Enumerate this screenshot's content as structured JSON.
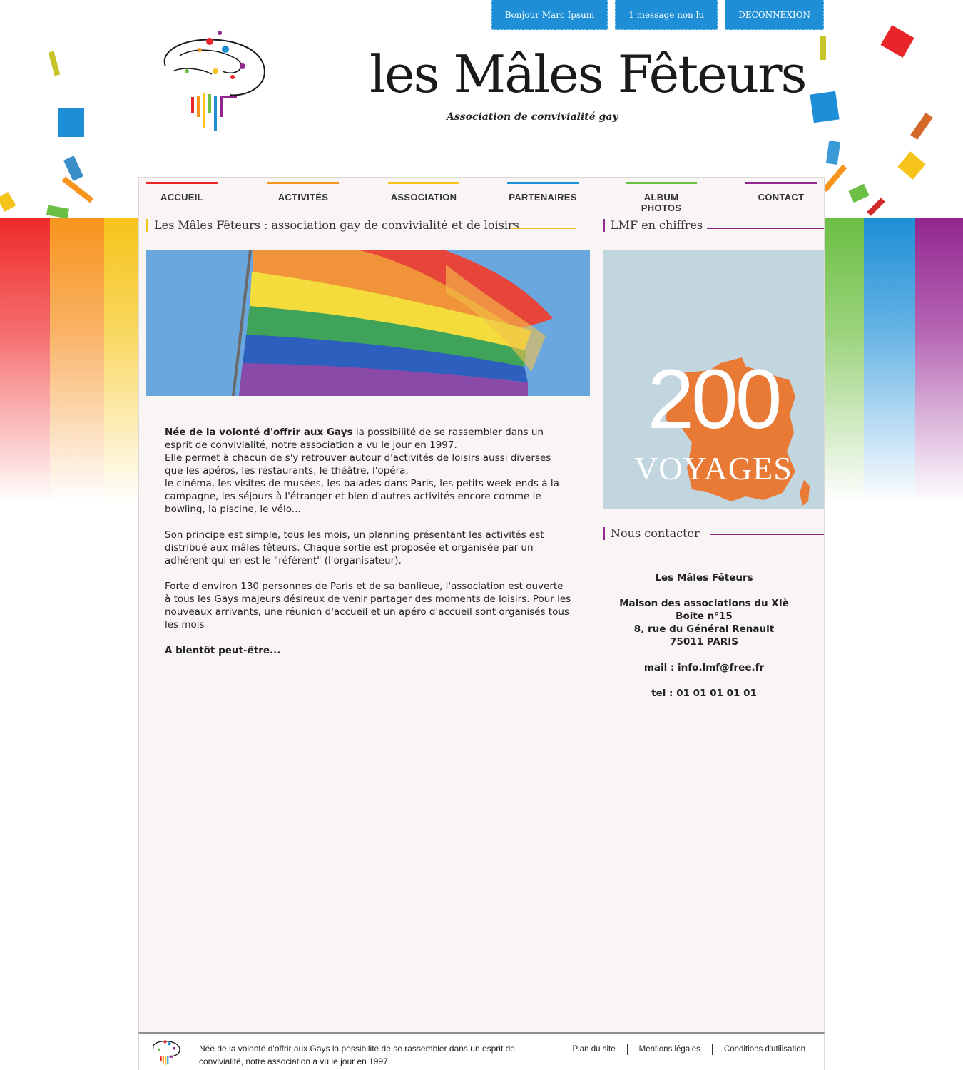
{
  "userbar": {
    "greeting": "Bonjour Marc Ipsum",
    "messages": "1 message non lu",
    "logout": "DECONNEXION"
  },
  "brand": {
    "title": "les Mâles Fêteurs",
    "tagline": "Association de convivialité gay"
  },
  "nav": {
    "items": [
      {
        "label": "ACCUEIL",
        "color": "#e8262a"
      },
      {
        "label": "ACTIVITÉS",
        "color": "#f7941d"
      },
      {
        "label": "ASSOCIATION",
        "color": "#f6c31a"
      },
      {
        "label": "PARTENAIRES",
        "color": "#1e8fd6"
      },
      {
        "label": "ALBUM PHOTOS",
        "color": "#6cbf45"
      },
      {
        "label": "CONTACT",
        "color": "#92278f"
      }
    ]
  },
  "main": {
    "title": "Les Mâles Fêteurs : association gay de convivialité et de loisirs",
    "p1_bold": "Née de la volonté d'offrir aux Gays",
    "p1_rest": " la possibilité de se rassembler dans un esprit de convivialité, notre association a vu le jour en 1997.",
    "p1_line2": "Elle permet à chacun de s'y retrouver autour d'activités de loisirs aussi diverses que les apéros, les restaurants, le théâtre, l'opéra,",
    "p1_line3": "le cinéma, les visites de musées, les balades dans Paris, les petits week-ends à la campagne, les séjours à l'étranger et bien d'autres activités encore comme le bowling, la piscine, le vélo...",
    "p2": "Son principe est simple, tous les mois, un planning présentant les activités est distribué aux mâles fêteurs. Chaque sortie est proposée et organisée par un adhérent qui en est le \"référent\" (l'organisateur).",
    "p3": "Forte d'environ 130 personnes de Paris et de sa banlieue, l'association est ouverte à tous les Gays majeurs désireux de venir partager des moments de loisirs. Pour les nouveaux arrivants, une réunion d'accueil et un apéro d'accueil sont organisés tous les mois",
    "p4": "A bientôt peut-être..."
  },
  "sidebar": {
    "stats_title": "LMF en chiffres",
    "stat_number": "200",
    "stat_label": "VOYAGES",
    "contact_title": "Nous contacter",
    "contact": {
      "name": "Les Mâles Fêteurs",
      "line1": "Maison des associations du XIè",
      "line2": "Boite n°15",
      "line3": "8, rue du Général Renault",
      "line4": "75011 PARIS",
      "mail": "mail : info.lmf@free.fr",
      "tel": "tel : 01 01 01 01 01"
    }
  },
  "footer": {
    "text": "Née de la volonté d'offrir aux Gays la possibilité de se rassembler dans un esprit de convivialité, notre association a vu le jour en 1997.",
    "links": [
      "Plan du site",
      "Mentions légales",
      "Conditions d'utilisation"
    ]
  },
  "colors": {
    "accent_blue": "#1e8fd6",
    "red": "#e8262a",
    "orange": "#f7941d",
    "yellow": "#f6c31a",
    "green": "#6cbf45",
    "blue": "#1e8fd6",
    "purple": "#92278f",
    "map_orange": "#e87a35"
  }
}
